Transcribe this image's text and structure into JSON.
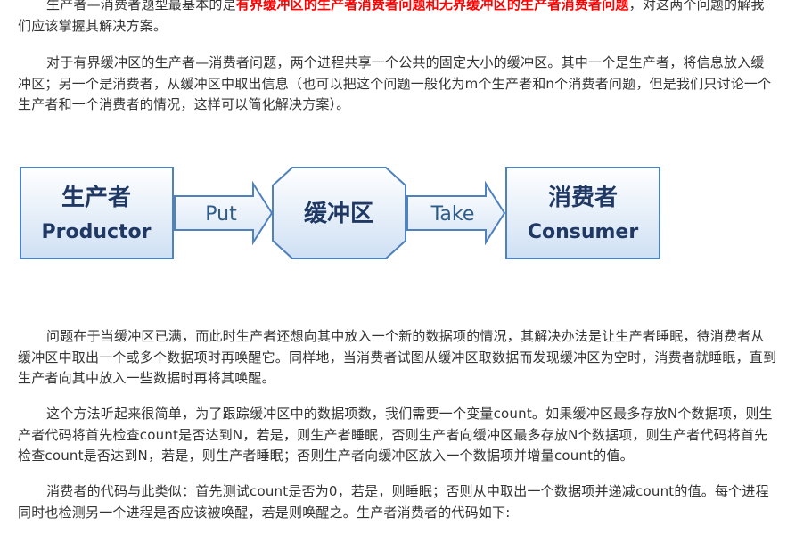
{
  "paragraphs": {
    "p1": {
      "pre": "生产者—消费者题型最基本的是",
      "highlight": "有界缓冲区的生产者消费者问题和无界缓冲区的生产者消费者问题",
      "post": "，对这两个问题的解我们应该掌握其解决方案。"
    },
    "p2": "对于有界缓冲区的生产者—消费者问题，两个进程共享一个公共的固定大小的缓冲区。其中一个是生产者，将信息放入缓冲区；另一个是消费者，从缓冲区中取出信息（也可以把这个问题一般化为m个生产者和n个消费者问题，但是我们只讨论一个生产者和一个消费者的情况，这样可以简化解决方案）。",
    "p3": "问题在于当缓冲区已满，而此时生产者还想向其中放入一个新的数据项的情况，其解决办法是让生产者睡眠，待消费者从缓冲区中取出一个或多个数据项时再唤醒它。同样地，当消费者试图从缓冲区取数据而发现缓冲区为空时，消费者就睡眠，直到生产者向其中放入一些数据时再将其唤醒。",
    "p4": "这个方法听起来很简单，为了跟踪缓冲区中的数据项数，我们需要一个变量count。如果缓冲区最多存放N个数据项，则生产者代码将首先检查count是否达到N，若是，则生产者睡眠，否则生产者向缓冲区最多存放N个数据项，则生产者代码将首先检查count是否达到N，若是，则生产者睡眠；否则生产者向缓冲区放入一个数据项并增量count的值。",
    "p5": "消费者的代码与此类似：首先测试count是否为0，若是，则睡眠；否则从中取出一个数据项并递减count的值。每个进程同时也检测另一个进程是否应该被唤醒，若是则唤醒之。生产者消费者的代码如下:"
  },
  "diagram": {
    "producer": {
      "cn": "生产者",
      "en": "Productor"
    },
    "put_label": "Put",
    "buffer": "缓冲区",
    "take_label": "Take",
    "consumer": {
      "cn": "消费者",
      "en": "Consumer"
    },
    "colors": {
      "border": "#4f81bd",
      "text": "#1f3864",
      "arrow_text": "#2e5c8a",
      "fill_top": "#ffffff",
      "fill_bottom": "#cfe0f3"
    }
  }
}
